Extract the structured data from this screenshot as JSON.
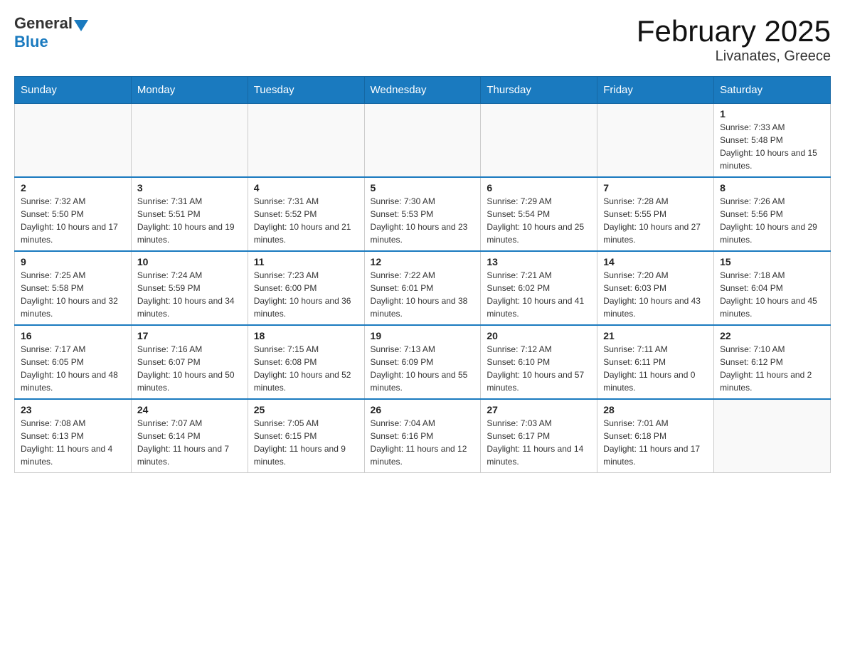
{
  "header": {
    "logo": {
      "general": "General",
      "blue": "Blue"
    },
    "title": "February 2025",
    "subtitle": "Livanates, Greece"
  },
  "days_of_week": [
    "Sunday",
    "Monday",
    "Tuesday",
    "Wednesday",
    "Thursday",
    "Friday",
    "Saturday"
  ],
  "weeks": [
    [
      {
        "day": "",
        "info": ""
      },
      {
        "day": "",
        "info": ""
      },
      {
        "day": "",
        "info": ""
      },
      {
        "day": "",
        "info": ""
      },
      {
        "day": "",
        "info": ""
      },
      {
        "day": "",
        "info": ""
      },
      {
        "day": "1",
        "info": "Sunrise: 7:33 AM\nSunset: 5:48 PM\nDaylight: 10 hours and 15 minutes."
      }
    ],
    [
      {
        "day": "2",
        "info": "Sunrise: 7:32 AM\nSunset: 5:50 PM\nDaylight: 10 hours and 17 minutes."
      },
      {
        "day": "3",
        "info": "Sunrise: 7:31 AM\nSunset: 5:51 PM\nDaylight: 10 hours and 19 minutes."
      },
      {
        "day": "4",
        "info": "Sunrise: 7:31 AM\nSunset: 5:52 PM\nDaylight: 10 hours and 21 minutes."
      },
      {
        "day": "5",
        "info": "Sunrise: 7:30 AM\nSunset: 5:53 PM\nDaylight: 10 hours and 23 minutes."
      },
      {
        "day": "6",
        "info": "Sunrise: 7:29 AM\nSunset: 5:54 PM\nDaylight: 10 hours and 25 minutes."
      },
      {
        "day": "7",
        "info": "Sunrise: 7:28 AM\nSunset: 5:55 PM\nDaylight: 10 hours and 27 minutes."
      },
      {
        "day": "8",
        "info": "Sunrise: 7:26 AM\nSunset: 5:56 PM\nDaylight: 10 hours and 29 minutes."
      }
    ],
    [
      {
        "day": "9",
        "info": "Sunrise: 7:25 AM\nSunset: 5:58 PM\nDaylight: 10 hours and 32 minutes."
      },
      {
        "day": "10",
        "info": "Sunrise: 7:24 AM\nSunset: 5:59 PM\nDaylight: 10 hours and 34 minutes."
      },
      {
        "day": "11",
        "info": "Sunrise: 7:23 AM\nSunset: 6:00 PM\nDaylight: 10 hours and 36 minutes."
      },
      {
        "day": "12",
        "info": "Sunrise: 7:22 AM\nSunset: 6:01 PM\nDaylight: 10 hours and 38 minutes."
      },
      {
        "day": "13",
        "info": "Sunrise: 7:21 AM\nSunset: 6:02 PM\nDaylight: 10 hours and 41 minutes."
      },
      {
        "day": "14",
        "info": "Sunrise: 7:20 AM\nSunset: 6:03 PM\nDaylight: 10 hours and 43 minutes."
      },
      {
        "day": "15",
        "info": "Sunrise: 7:18 AM\nSunset: 6:04 PM\nDaylight: 10 hours and 45 minutes."
      }
    ],
    [
      {
        "day": "16",
        "info": "Sunrise: 7:17 AM\nSunset: 6:05 PM\nDaylight: 10 hours and 48 minutes."
      },
      {
        "day": "17",
        "info": "Sunrise: 7:16 AM\nSunset: 6:07 PM\nDaylight: 10 hours and 50 minutes."
      },
      {
        "day": "18",
        "info": "Sunrise: 7:15 AM\nSunset: 6:08 PM\nDaylight: 10 hours and 52 minutes."
      },
      {
        "day": "19",
        "info": "Sunrise: 7:13 AM\nSunset: 6:09 PM\nDaylight: 10 hours and 55 minutes."
      },
      {
        "day": "20",
        "info": "Sunrise: 7:12 AM\nSunset: 6:10 PM\nDaylight: 10 hours and 57 minutes."
      },
      {
        "day": "21",
        "info": "Sunrise: 7:11 AM\nSunset: 6:11 PM\nDaylight: 11 hours and 0 minutes."
      },
      {
        "day": "22",
        "info": "Sunrise: 7:10 AM\nSunset: 6:12 PM\nDaylight: 11 hours and 2 minutes."
      }
    ],
    [
      {
        "day": "23",
        "info": "Sunrise: 7:08 AM\nSunset: 6:13 PM\nDaylight: 11 hours and 4 minutes."
      },
      {
        "day": "24",
        "info": "Sunrise: 7:07 AM\nSunset: 6:14 PM\nDaylight: 11 hours and 7 minutes."
      },
      {
        "day": "25",
        "info": "Sunrise: 7:05 AM\nSunset: 6:15 PM\nDaylight: 11 hours and 9 minutes."
      },
      {
        "day": "26",
        "info": "Sunrise: 7:04 AM\nSunset: 6:16 PM\nDaylight: 11 hours and 12 minutes."
      },
      {
        "day": "27",
        "info": "Sunrise: 7:03 AM\nSunset: 6:17 PM\nDaylight: 11 hours and 14 minutes."
      },
      {
        "day": "28",
        "info": "Sunrise: 7:01 AM\nSunset: 6:18 PM\nDaylight: 11 hours and 17 minutes."
      },
      {
        "day": "",
        "info": ""
      }
    ]
  ]
}
